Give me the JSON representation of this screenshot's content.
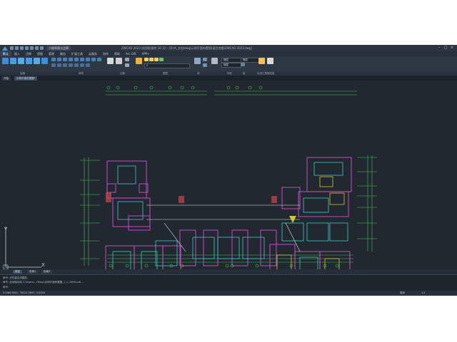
{
  "titlebar": {
    "app_tab": "二维草图与注释",
    "title": "ZWCAD 2023 试用版(剩余 30 天) - [D:\\A_文档\\dwg\\示例平面布置图(某住宅楼)ZWCAD 2023.dwg]",
    "min_glyph": "–",
    "max_glyph": "□",
    "close_glyph": "×"
  },
  "menu": {
    "tabs": [
      "默认",
      "插入",
      "注释",
      "视图",
      "管理",
      "输出",
      "扩展工具",
      "云服务",
      "协作",
      "帮助",
      "Arc GIS",
      "APP+"
    ]
  },
  "ribbon": {
    "groups": [
      "绘图",
      "修改",
      "注释",
      "图层",
      "块",
      "特性",
      "组",
      "实用工具",
      "剪贴板"
    ],
    "layer_combo": "0",
    "color_combo": "随层",
    "linetype_combo": "随层",
    "lineweight_combo": "随层"
  },
  "filetabs": [
    "开始",
    "示例平面布置图*"
  ],
  "layouttabs": [
    "模型",
    "布局1",
    "布局2"
  ],
  "axis": {
    "x_label": "X",
    "y_label": "Y"
  },
  "command": {
    "line1": "命令: 正在重生成模型。",
    "line2": "命令: 自动保存到 C:\\Users\\...\\Temp\\示例平面布置图_1_1_3456.sv$ ...",
    "prompt": "命令:"
  },
  "status": {
    "coords": "57480.5601, 78122.3853, 0.0000",
    "units": "毫米",
    "scale": "1:1"
  },
  "colors": {
    "magenta": "#d64fd6",
    "cyan": "#3fc7c7",
    "green": "#49c453",
    "yellow": "#d6c23a",
    "white": "#e6e6e6",
    "red": "#c94848",
    "blue": "#4b6fd6"
  }
}
